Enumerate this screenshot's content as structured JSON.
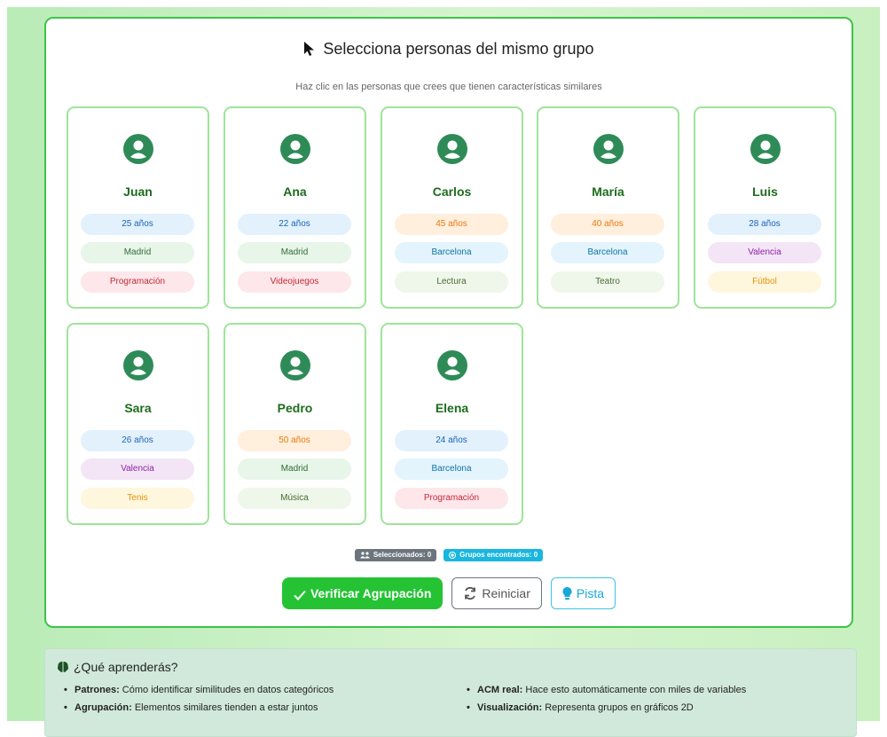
{
  "header": {
    "title": "Selecciona personas del mismo grupo",
    "subtitle": "Haz clic en las personas que crees que tienen características similares"
  },
  "colors": {
    "tag_blue_bg": "#e3f1fd",
    "tag_blue_fg": "#1c64b5",
    "tag_orange_bg": "#ffefdc",
    "tag_orange_fg": "#e67a12",
    "tag_green_bg": "#e8f5e9",
    "tag_green_fg": "#2e6e34",
    "tag_pink_bg": "#fde7ea",
    "tag_pink_fg": "#c62839",
    "tag_cyan_bg": "#e3f4fc",
    "tag_cyan_fg": "#0f73a6",
    "tag_lime_bg": "#eff6ea",
    "tag_lime_fg": "#486b35",
    "tag_purple_bg": "#f3e5f5",
    "tag_purple_fg": "#8e24aa",
    "tag_yellow_bg": "#fff6de",
    "tag_yellow_fg": "#e6930c"
  },
  "persons": [
    {
      "name": "Juan",
      "age": "25 años",
      "city": "Madrid",
      "hobby": "Programación"
    },
    {
      "name": "Ana",
      "age": "22 años",
      "city": "Madrid",
      "hobby": "Videojuegos"
    },
    {
      "name": "Carlos",
      "age": "45 años",
      "city": "Barcelona",
      "hobby": "Lectura"
    },
    {
      "name": "María",
      "age": "40 años",
      "city": "Barcelona",
      "hobby": "Teatro"
    },
    {
      "name": "Luis",
      "age": "28 años",
      "city": "Valencia",
      "hobby": "Fútbol"
    },
    {
      "name": "Sara",
      "age": "26 años",
      "city": "Valencia",
      "hobby": "Tenis"
    },
    {
      "name": "Pedro",
      "age": "50 años",
      "city": "Madrid",
      "hobby": "Música"
    },
    {
      "name": "Elena",
      "age": "24 años",
      "city": "Barcelona",
      "hobby": "Programación"
    }
  ],
  "counters": {
    "selected": "Seleccionados: 0",
    "groups": "Grupos encontrados: 0"
  },
  "buttons": {
    "verify": "Verificar Agrupación",
    "reset": "Reiniciar",
    "hint": "Pista"
  },
  "learn": {
    "title": "¿Qué aprenderás?",
    "items": [
      {
        "label": "Patrones:",
        "text": " Cómo identificar similitudes en datos categóricos"
      },
      {
        "label": "Agrupación:",
        "text": " Elementos similares tienden a estar juntos"
      },
      {
        "label": "ACM real:",
        "text": " Hace esto automáticamente con miles de variables"
      },
      {
        "label": "Visualización:",
        "text": " Representa grupos en gráficos 2D"
      }
    ]
  }
}
